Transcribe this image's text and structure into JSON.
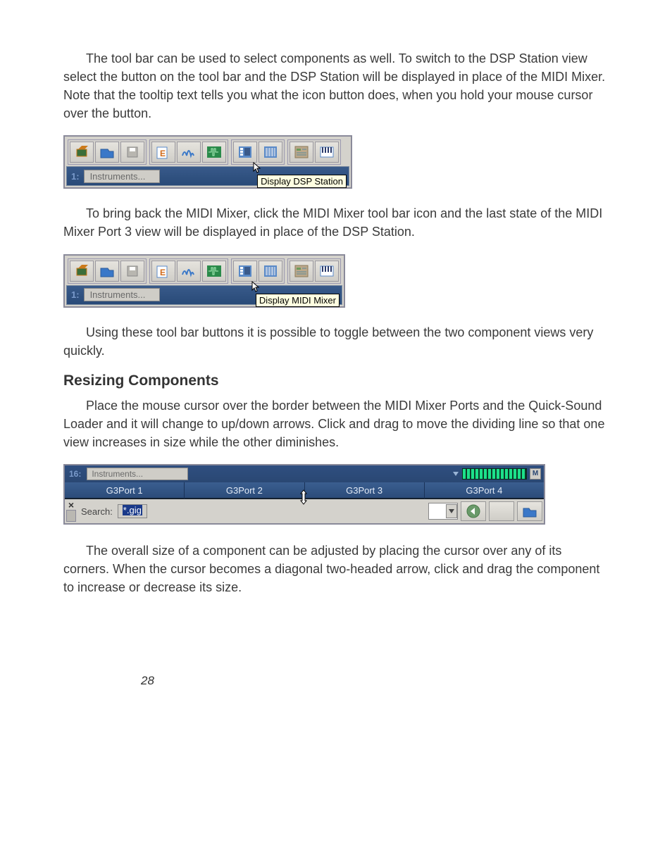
{
  "paragraphs": {
    "p1": "The tool bar can be used to select components as well. To switch to the DSP Station view select the button on the tool bar and the DSP Station will be displayed in place of the MIDI Mixer. Note that the tooltip text tells you what the icon button does, when you hold your mouse cursor over the button.",
    "p2": "To bring back the MIDI Mixer, click the MIDI Mixer tool bar icon and the last state of the MIDI Mixer Port 3 view will be displayed in place of the DSP Station.",
    "p3": "Using these tool bar buttons it is possible to toggle between the two component views very quickly.",
    "h1": "Resizing Components",
    "p4": "Place the mouse cursor over the border between the MIDI Mixer Ports and the Quick-Sound Loader and it will change to up/down arrows. Click and drag to move the dividing line so that one view increases in size while the other diminishes.",
    "p5": "The overall size of a component can be adjusted by placing the cursor over any of its corners. When the cursor becomes a diagonal two-headed arrow, click and drag the component to increase or decrease its size."
  },
  "fig1": {
    "status_num": "1:",
    "status_field": "Instruments...",
    "tooltip": "Display DSP Station"
  },
  "fig2": {
    "status_num": "1:",
    "status_field": "Instruments...",
    "tooltip": "Display MIDI Mixer"
  },
  "fig3": {
    "top_num": "16:",
    "top_field": "Instruments...",
    "m_label": "M",
    "tabs": [
      "G3Port 1",
      "G3Port 2",
      "G3Port 3",
      "G3Port 4"
    ],
    "search_label": "Search:",
    "search_value": "*.gig",
    "close": "×"
  },
  "page_number": "28"
}
